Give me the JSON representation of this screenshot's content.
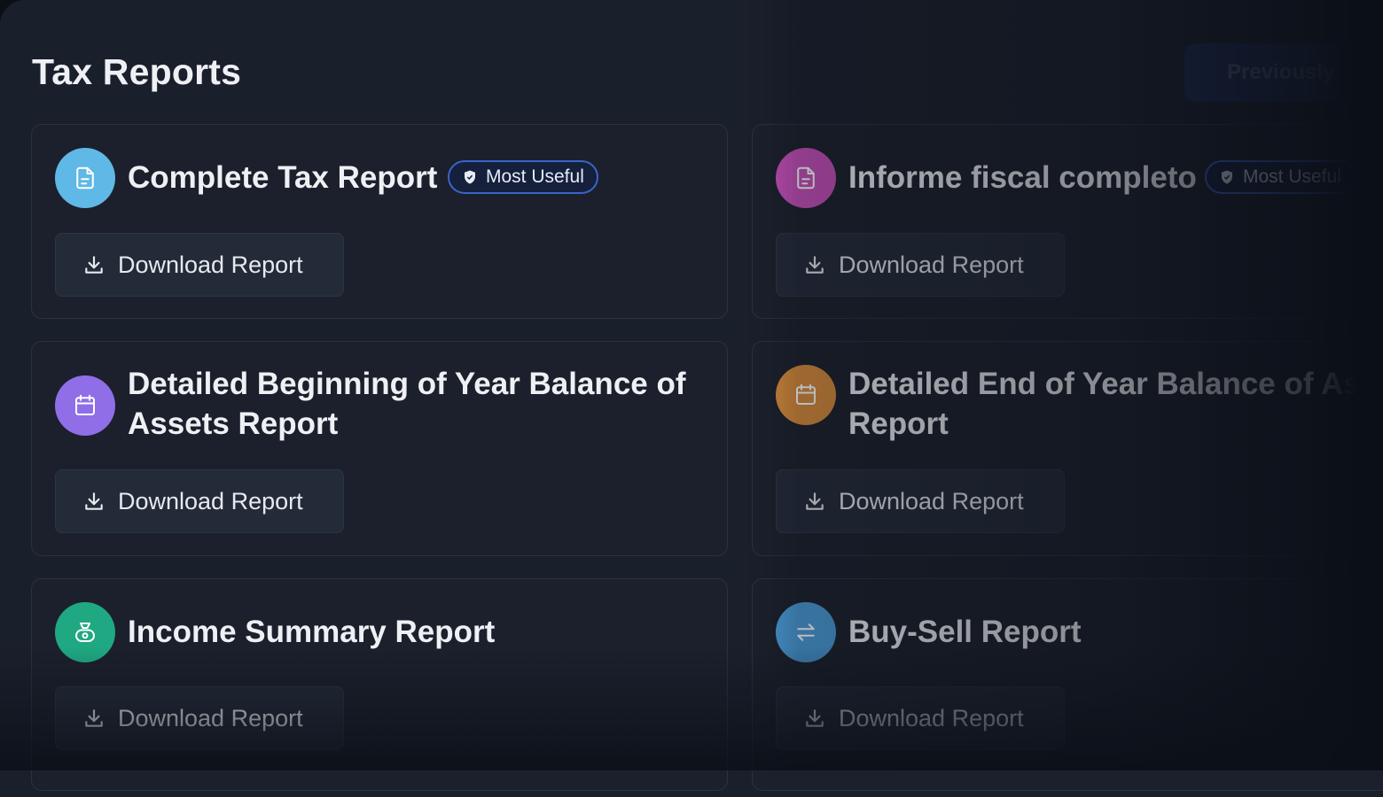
{
  "header": {
    "title": "Tax Reports",
    "previous_label": "Previously"
  },
  "badge_label": "Most Useful",
  "reports": [
    {
      "title": "Complete Tax Report",
      "button": "Download Report",
      "icon": "document-icon",
      "color": "#5fb8e6"
    },
    {
      "title": "Informe fiscal completo",
      "button": "Download Report",
      "icon": "document-icon",
      "color": "#c44fb8"
    },
    {
      "title_line1": "Detailed Beginning of Year Balance of",
      "title_line2": "Assets Report",
      "button": "Download Report",
      "icon": "calendar-icon",
      "color": "#8f6ee8"
    },
    {
      "title_line1": "Detailed End of Year Balance of Assets",
      "title_line2": "Report",
      "button": "Download Report",
      "icon": "calendar-icon",
      "color": "#d68a3a"
    },
    {
      "title": "Income Summary Report",
      "button": "Download Report",
      "icon": "money-bag-icon",
      "color": "#1fa882"
    },
    {
      "title": "Buy-Sell Report",
      "button": "Download Report",
      "icon": "swap-arrows-icon",
      "color": "#4a9ad6"
    }
  ]
}
